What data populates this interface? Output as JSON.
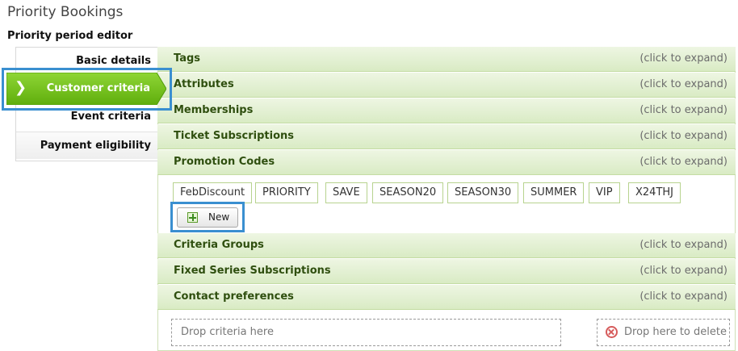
{
  "page": {
    "title": "Priority Bookings",
    "editor_title": "Priority period editor"
  },
  "nav": {
    "items": [
      {
        "label": "Basic details"
      },
      {
        "label": "Customer criteria",
        "active": true
      },
      {
        "label": "Event criteria"
      },
      {
        "label": "Payment eligibility"
      }
    ],
    "active_arrow": "❯"
  },
  "sections": [
    {
      "title": "Tags",
      "hint": "(click to expand)"
    },
    {
      "title": "Attributes",
      "hint": "(click to expand)"
    },
    {
      "title": "Memberships",
      "hint": "(click to expand)"
    },
    {
      "title": "Ticket Subscriptions",
      "hint": "(click to expand)"
    },
    {
      "title": "Promotion Codes",
      "hint": "(click to expand)"
    },
    {
      "title": "Criteria Groups",
      "hint": "(click to expand)"
    },
    {
      "title": "Fixed Series Subscriptions",
      "hint": "(click to expand)"
    },
    {
      "title": "Contact preferences",
      "hint": "(click to expand)"
    }
  ],
  "promotion_codes": [
    "FebDiscount",
    "PRIORITY",
    "SAVE",
    "SEASON20",
    "SEASON30",
    "SUMMER",
    "VIP",
    "X24THJ"
  ],
  "new_button": {
    "label": "New",
    "icon": "plus-icon"
  },
  "drop_zones": {
    "criteria": "Drop criteria here",
    "delete": "Drop here to delete",
    "delete_icon": "close-circle-icon"
  },
  "colors": {
    "active_nav": "#6cbf12",
    "highlight": "#3a8fd0",
    "section_text": "#2f4f0f"
  }
}
